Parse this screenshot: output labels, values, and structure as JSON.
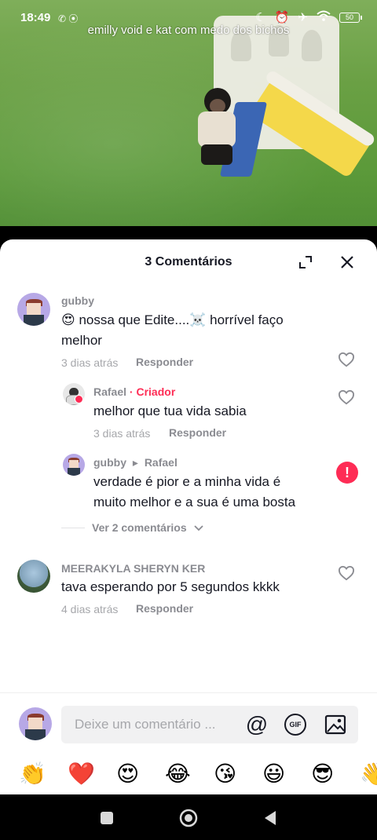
{
  "status_bar": {
    "time": "18:49",
    "left_icons": "✆ ⦿",
    "right_icons": [
      "moon-icon",
      "alarm-off-icon",
      "airplane-icon",
      "wifi-icon"
    ],
    "battery": "50"
  },
  "video": {
    "caption": "emilly void e kat com medo dos bichos"
  },
  "comments_sheet": {
    "title": "3 Comentários",
    "comments": [
      {
        "username": "gubby",
        "emoji_prefix": "😍",
        "text_line1": " nossa que Edite....☠️ horrível faço",
        "text_line2": "melhor",
        "time": "3 dias atrás",
        "reply": "Responder"
      },
      {
        "username": "Rafael",
        "separator": " · ",
        "creator_tag": "Criador",
        "text": "melhor que tua vida sabia",
        "time": "3 dias atrás",
        "reply": "Responder"
      },
      {
        "username": "gubby",
        "reply_arrow": "▸",
        "reply_to": "Rafael",
        "text_line1": "verdade é pior e a minha vida é",
        "text_line2": "muito melhor e a sua é uma bosta",
        "error_icon": "!"
      },
      {
        "username": "MEERAKYLA SHERYN KER",
        "text": "tava esperando por 5 segundos kkkk",
        "time": "4 dias atrás",
        "reply": "Responder"
      }
    ],
    "view_more": "Ver 2 comentários"
  },
  "input_bar": {
    "placeholder": "Deixe um comentário ...",
    "mention_icon": "@",
    "gif_label": "GIF"
  },
  "emoji_bar": [
    "👏",
    "❤️",
    "😍",
    "😂",
    "😘",
    "😃",
    "😎",
    "👋"
  ],
  "colors": {
    "accent": "#fe2c55",
    "text_primary": "#161823",
    "text_secondary": "#8a8b91"
  }
}
